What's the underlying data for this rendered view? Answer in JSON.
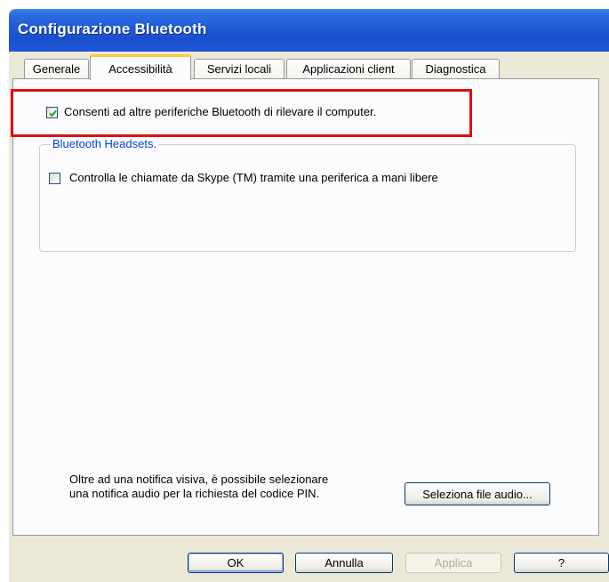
{
  "window": {
    "title": "Configurazione Bluetooth"
  },
  "tabs": [
    {
      "label": "Generale",
      "active": false
    },
    {
      "label": "Accessibilità",
      "active": true
    },
    {
      "label": "Servizi locali",
      "active": false
    },
    {
      "label": "Applicazioni client",
      "active": false
    },
    {
      "label": "Diagnostica",
      "active": false
    }
  ],
  "discoverable": {
    "label": "Consenti ad altre periferiche Bluetooth di rilevare il computer.",
    "checked": true
  },
  "headsets": {
    "group_title": "Bluetooth Headsets.",
    "skype_label": "Controlla le chiamate da Skype (TM) tramite una periferica a mani libere",
    "skype_checked": false
  },
  "audio_info": {
    "line1": "Oltre ad una notifica visiva, è possibile selezionare",
    "line2": "una notifica audio per la richiesta del codice PIN.",
    "button": "Seleziona file audio..."
  },
  "buttons": {
    "ok": "OK",
    "cancel": "Annulla",
    "apply": "Applica",
    "help": "?"
  },
  "colors": {
    "highlight": "#e01010",
    "titlebar": "#1f5ad6",
    "active_tab_accent": "#ffc73c"
  }
}
